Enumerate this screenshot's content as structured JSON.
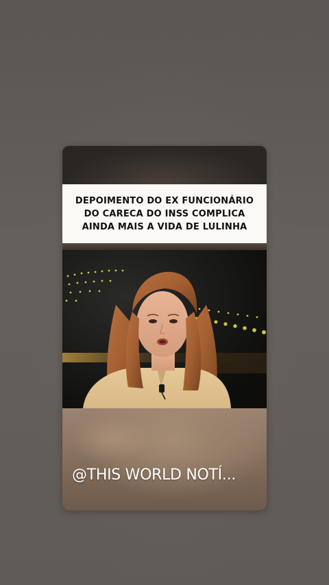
{
  "post": {
    "headline_lines": [
      "DEPOIMENTO DO EX FUNCIONÁRIO",
      "DO CARECA DO INSS COMPLICA",
      "AINDA MAIS A VIDA DE LULINHA"
    ],
    "watermark": "@THIS WORLD NOTÍ..."
  },
  "colors": {
    "page_background": "#5f5b57",
    "headline_background": "#fbf9f6",
    "headline_text": "#111111",
    "watermark_text": "#ffffff",
    "studio_lights": "#f2e14a"
  },
  "icons": {
    "lapel_microphone": "microphone-icon"
  }
}
